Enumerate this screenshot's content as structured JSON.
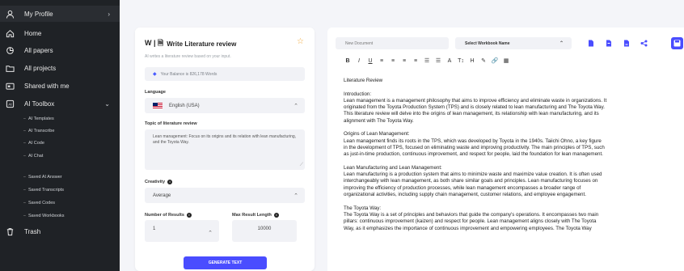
{
  "sidebar": {
    "profile": {
      "label": "My Profile",
      "icon": "user-icon"
    },
    "items": [
      {
        "label": "Home",
        "icon": "home-icon"
      },
      {
        "label": "All papers",
        "icon": "papers-icon"
      },
      {
        "label": "All projects",
        "icon": "folder-icon"
      },
      {
        "label": "Shared with me",
        "icon": "shared-icon"
      },
      {
        "label": "AI Toolbox",
        "icon": "ai-icon"
      }
    ],
    "toolbox_sub": [
      "AI Templates",
      "AI Transcribe",
      "AI Code",
      "AI Chat"
    ],
    "saved_sub": [
      "Saved AI Answer",
      "Saved Transcripts",
      "Saved Codes",
      "Saved Workbooks"
    ],
    "trash": {
      "label": "Trash",
      "icon": "trash-icon"
    }
  },
  "tool": {
    "brand": "W | 🗎",
    "title": "Write Literature review",
    "subtitle": "AI writes a literature review based on your input.",
    "balance": "Your Balance is 826,178 Words",
    "language_label": "Language",
    "language_value": "English (USA)",
    "topic_label": "Topic of literature review",
    "topic_value": "Lean management: Focus on its origins and its relation with lean manufacturing, and the Toyota Way.",
    "creativity_label": "Creativity",
    "creativity_value": "Average",
    "results_label": "Number of Results",
    "results_value": "1",
    "maxlen_label": "Max Result Length",
    "maxlen_value": "10000",
    "generate_label": "GENERATE TEXT"
  },
  "editor": {
    "doc_name_placeholder": "New Document",
    "workbook_select": "Select Workbook Name",
    "format_tools": [
      "B",
      "I",
      "U",
      "≡",
      "≡",
      "≡",
      "≡",
      "☰",
      "☰",
      "A",
      "T↕",
      "H",
      "✎",
      "🔗",
      "▦"
    ],
    "content": [
      "Literature Review",
      "",
      "Introduction:",
      "Lean management is a management philosophy that aims to improve efficiency and eliminate waste in organizations. It",
      "originated from the Toyota Production System (TPS) and is closely related to lean manufacturing and The Toyota Way.",
      "This literature review will delve into the origins of lean management, its relationship with lean manufacturing, and its",
      "alignment with The Toyota Way.",
      "",
      "Origins of Lean Management:",
      "Lean management finds its roots in the TPS, which was developed by Toyota in the 1940s. Taiichi Ohno, a key figure",
      "in the development of TPS, focused on eliminating waste and improving productivity. The main principles of TPS, such",
      "as just-in-time production, continuous improvement, and respect for people, laid the foundation for lean management.",
      "",
      "Lean Manufacturing and Lean Management:",
      "Lean manufacturing is a production system that aims to minimize waste and maximize value creation. It is often used",
      "interchangeably with lean management, as both share similar goals and principles. Lean manufacturing focuses on",
      "improving the efficiency of production processes, while lean management encompasses a broader range of",
      "organizational activities, including supply chain management, customer relations, and employee engagement.",
      "",
      "The Toyota Way:",
      "The Toyota Way is a set of principles and behaviors that guide the company's operations. It encompasses two main",
      "pillars: continuous improvement (kaizen) and respect for people. Lean management aligns closely with The Toyota",
      "Way, as it emphasizes the importance of continuous improvement and empowering employees. The Toyota Way"
    ]
  },
  "colors": {
    "accent": "#4a4dff",
    "sidebar_bg": "#1f2226",
    "star": "#f2a93b"
  }
}
